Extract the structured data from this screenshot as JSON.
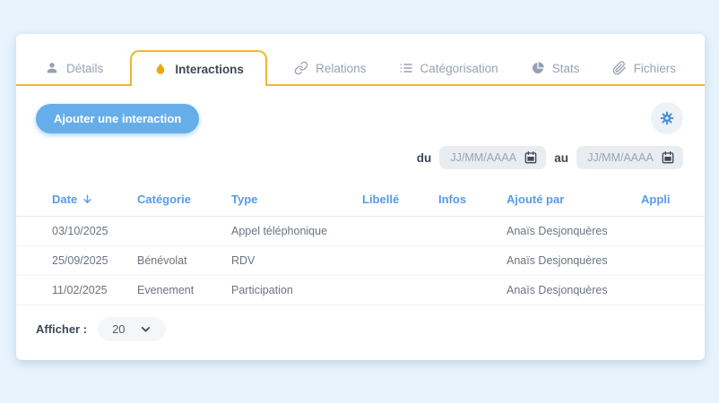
{
  "tabs": [
    {
      "label": "Détails",
      "icon": "user-icon",
      "active": false
    },
    {
      "label": "Interactions",
      "icon": "flame-icon",
      "active": true
    },
    {
      "label": "Relations",
      "icon": "link-icon",
      "active": false
    },
    {
      "label": "Catégorisation",
      "icon": "list-icon",
      "active": false
    },
    {
      "label": "Stats",
      "icon": "pie-chart-icon",
      "active": false
    },
    {
      "label": "Fichiers",
      "icon": "paperclip-icon",
      "active": false
    }
  ],
  "toolbar": {
    "add_button_label": "Ajouter une interaction",
    "settings_icon": "gear-icon"
  },
  "filters": {
    "from_label": "du",
    "to_label": "au",
    "date_placeholder": "JJ/MM/AAAA",
    "from_value": "",
    "to_value": "",
    "calendar_icon": "calendar-icon"
  },
  "table": {
    "columns": [
      "Date",
      "Catégorie",
      "Type",
      "Libellé",
      "Infos",
      "Ajouté par",
      "Appli"
    ],
    "sorted_column": "Date",
    "sort_direction": "desc",
    "sort_icon": "arrow-down-icon",
    "rows": [
      {
        "date": "03/10/2025",
        "categorie": "",
        "type": "Appel téléphonique",
        "libelle": "",
        "infos": "",
        "ajoute_par": "Anaïs Desjonquères",
        "appli": ""
      },
      {
        "date": "25/09/2025",
        "categorie": "Bénévolat",
        "type": "RDV",
        "libelle": "",
        "infos": "",
        "ajoute_par": "Anaïs Desjonquères",
        "appli": ""
      },
      {
        "date": "11/02/2025",
        "categorie": "Evenement",
        "type": "Participation",
        "libelle": "",
        "infos": "",
        "ajoute_par": "Anaïs Desjonquères",
        "appli": ""
      }
    ]
  },
  "footer": {
    "label": "Afficher :",
    "page_size": "20",
    "chevron_icon": "chevron-down-icon"
  },
  "colors": {
    "page_background": "#e7f3fd",
    "accent_gold": "#efb537",
    "flame_gold": "#e9a90f",
    "header_blue": "#559ce9",
    "button_blue": "#66aee9",
    "gear_blue": "#4a90d9"
  }
}
